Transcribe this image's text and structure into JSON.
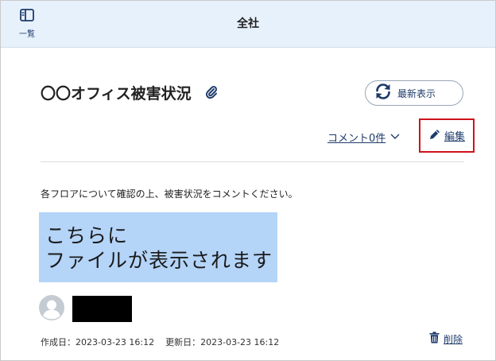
{
  "header": {
    "title": "全社",
    "list_label": "一覧"
  },
  "post": {
    "title": "〇〇オフィス被害状況",
    "refresh_label": "最新表示",
    "comment_label": "コメント0件",
    "edit_label": "編集",
    "description": "各フロアについて確認の上、被害状況をコメントください。",
    "file_placeholder": [
      "こちらに",
      "ファイルが表示されます"
    ],
    "created_label": "作成日：",
    "created_value": "2023-03-23 16:12",
    "updated_label": "更新日：",
    "updated_value": "2023-03-23 16:12",
    "delete_label": "削除"
  },
  "colors": {
    "header_bg": "#e7f1fc",
    "link": "#1d3b6b",
    "highlight_border": "#d0121b",
    "file_bg": "#b4d4f8"
  },
  "icons": [
    "sidebar-panel-icon",
    "paperclip-icon",
    "refresh-icon",
    "chevron-down-icon",
    "pencil-icon",
    "user-avatar-icon",
    "trash-icon"
  ]
}
